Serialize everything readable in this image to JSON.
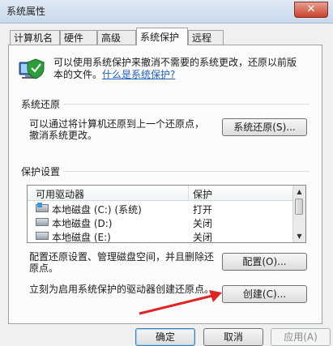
{
  "window": {
    "title": "系统属性",
    "close_glyph": "✕"
  },
  "tabs": [
    {
      "label": "计算机名"
    },
    {
      "label": "硬件"
    },
    {
      "label": "高级"
    },
    {
      "label": "系统保护",
      "active": true
    },
    {
      "label": "远程"
    }
  ],
  "intro": {
    "line1": "可以使用系统保护来撤消不需要的系统更改，还原以前版",
    "line2_prefix": "本的文件。",
    "link": "什么是系统保护?"
  },
  "restore": {
    "group_label": "系统还原",
    "desc_line1": "可以通过将计算机还原到上一个还原点，",
    "desc_line2": "撤消系统更改。",
    "button": "系统还原(S)..."
  },
  "protection": {
    "group_label": "保护设置",
    "columns": [
      "可用驱动器",
      "保护"
    ],
    "drives": [
      {
        "name": "本地磁盘 (C:) (系统)",
        "status": "打开",
        "icon": "system-drive-icon"
      },
      {
        "name": "本地磁盘 (D:)",
        "status": "关闭",
        "icon": "drive-icon"
      },
      {
        "name": "本地磁盘 (E:)",
        "status": "关闭",
        "icon": "drive-icon"
      }
    ],
    "config_line1": "配置还原设置、管理磁盘空间，并且删除还",
    "config_line2": "原点。",
    "config_button": "配置(O)...",
    "create_text": "立刻为启用系统保护的驱动器创建还原点。",
    "create_button": "创建(C)..."
  },
  "footer": {
    "ok": "确定",
    "cancel": "取消",
    "apply": "应用(A)"
  },
  "colors": {
    "arrow": "#e02424",
    "link": "#1f5fbf"
  }
}
